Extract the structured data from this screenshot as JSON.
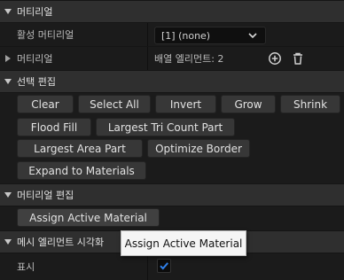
{
  "sections": {
    "material": {
      "title": "머티리얼",
      "active_material_label": "활성 머티리얼",
      "active_material_value": "[1] (none)",
      "material_label": "머티리얼",
      "material_value": "배열 엘리먼트: 2"
    },
    "selection_edit": {
      "title": "선택 편집",
      "buttons": {
        "clear": "Clear",
        "select_all": "Select All",
        "invert": "Invert",
        "grow": "Grow",
        "shrink": "Shrink",
        "flood_fill": "Flood Fill",
        "largest_tri_count_part": "Largest Tri Count Part",
        "largest_area_part": "Largest Area Part",
        "optimize_border": "Optimize Border",
        "expand_to_materials": "Expand to Materials"
      }
    },
    "material_edit": {
      "title": "머티리얼 편집",
      "assign_active_material": "Assign Active Material"
    },
    "mesh_element_vis": {
      "title": "메시 엘리먼트 시각화",
      "show_label": "표시",
      "show_checked": true
    }
  },
  "tooltip": {
    "text": "Assign Active Material"
  },
  "icons": {
    "add": "plus-circle-icon",
    "delete": "trash-icon",
    "dropdown": "chevron-down-icon",
    "check": "check-icon"
  },
  "colors": {
    "background": "#151515",
    "header": "#2f2f2f",
    "button": "#373737",
    "check_accent": "#1f6fd6"
  }
}
